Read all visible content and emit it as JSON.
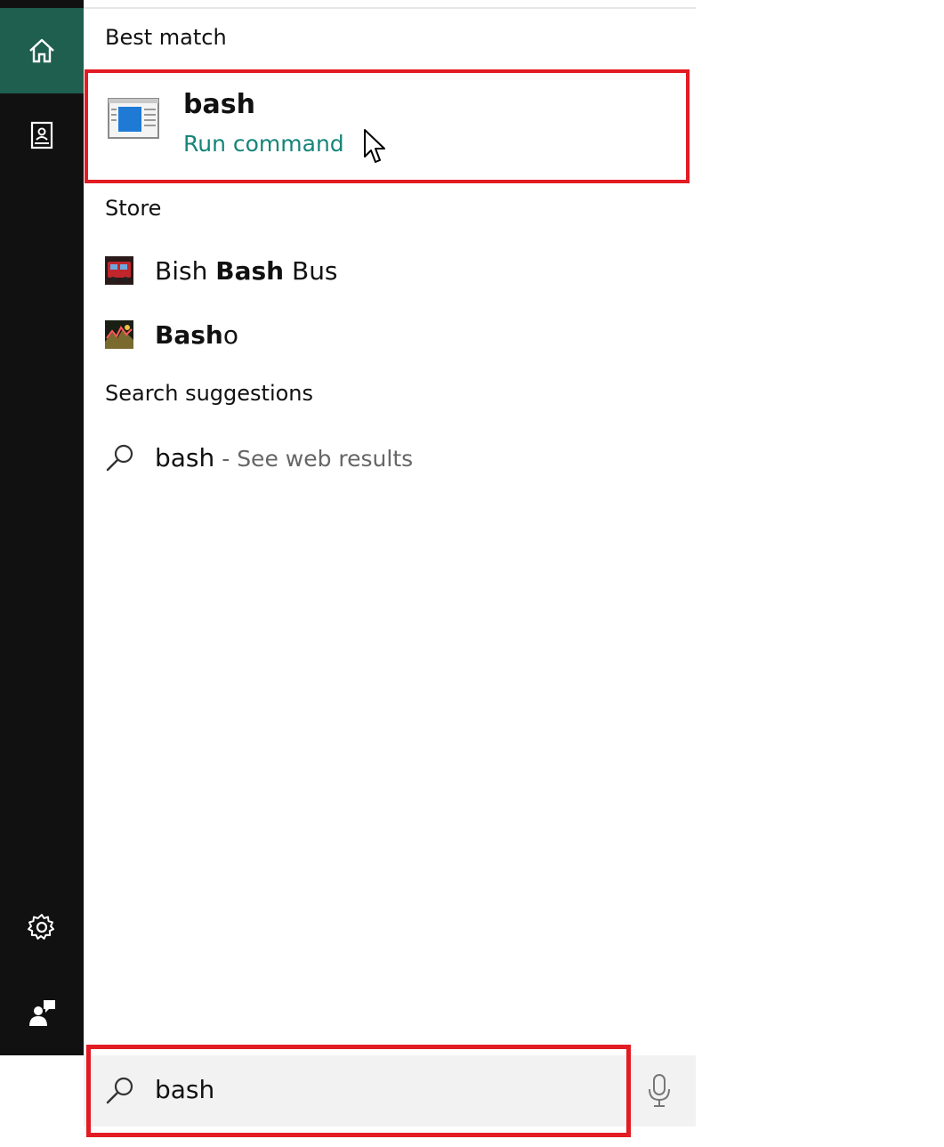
{
  "best_match": {
    "title": "Best match",
    "name": "bash",
    "subtitle": "Run command"
  },
  "store": {
    "title": "Store",
    "items": [
      {
        "prefix": "Bish ",
        "match": "Bash",
        "suffix": " Bus",
        "icon": "bish-bash-bus-app-icon"
      },
      {
        "prefix": "",
        "match": "Bash",
        "suffix": "o",
        "icon": "basho-app-icon"
      }
    ]
  },
  "suggestions": {
    "title": "Search suggestions",
    "items": [
      {
        "query": "bash",
        "separator": " - ",
        "hint": "See web results"
      }
    ]
  },
  "search": {
    "value": "bash"
  },
  "colors": {
    "sidebar": "#111111",
    "home_active": "#1e5f4f",
    "accent_text": "#16857a",
    "highlight_border": "#e31b23",
    "search_bar": "#f2f2f2"
  }
}
